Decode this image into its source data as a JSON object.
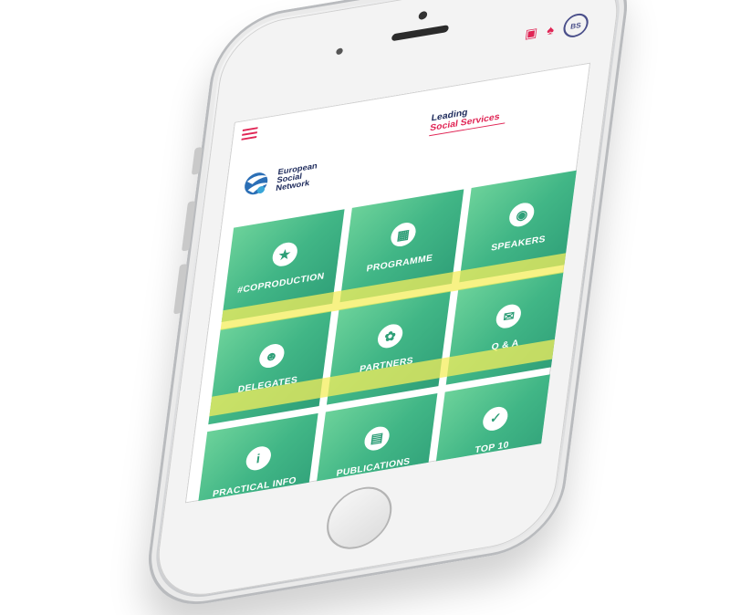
{
  "status_bar": {
    "chat_icon": "chat-icon",
    "bell_icon": "bell-icon",
    "avatar_initials": "BS"
  },
  "app": {
    "menu_icon": "hamburger-menu-icon",
    "brand": {
      "line1": "European",
      "line2": "Social",
      "line3": "Network"
    },
    "tagline": {
      "line1": "Leading",
      "line2": "Social Services"
    }
  },
  "tiles": [
    {
      "label": "#COPRODUCTION",
      "icon": "★",
      "icon_name": "star-icon"
    },
    {
      "label": "PROGRAMME",
      "icon": "▦",
      "icon_name": "calendar-icon"
    },
    {
      "label": "SPEAKERS",
      "icon": "🎙",
      "icon_name": "microphone-icon"
    },
    {
      "label": "",
      "icon": "",
      "icon_name": ""
    },
    {
      "label": "PARTNERS",
      "icon": "✿",
      "icon_name": "handshake-icon"
    },
    {
      "label": "Q & A",
      "icon": "✉",
      "icon_name": "chat-bubbles-icon"
    },
    {
      "label": "DELEGATES",
      "icon": "👥",
      "icon_name": "people-icon"
    },
    {
      "label": "PUBLICATIONS",
      "icon": "▤",
      "icon_name": "document-icon"
    },
    {
      "label": "TOP 10",
      "icon": "✓",
      "icon_name": "checklist-icon"
    }
  ],
  "extra_tile": {
    "label": "PRACTICAL INFO",
    "icon": "i",
    "icon_name": "info-icon"
  },
  "colors": {
    "accent_red": "#e02454",
    "brand_navy": "#1e2b5c",
    "tile_green": "#41b686",
    "highlight_yellow": "#f4ee5c"
  }
}
